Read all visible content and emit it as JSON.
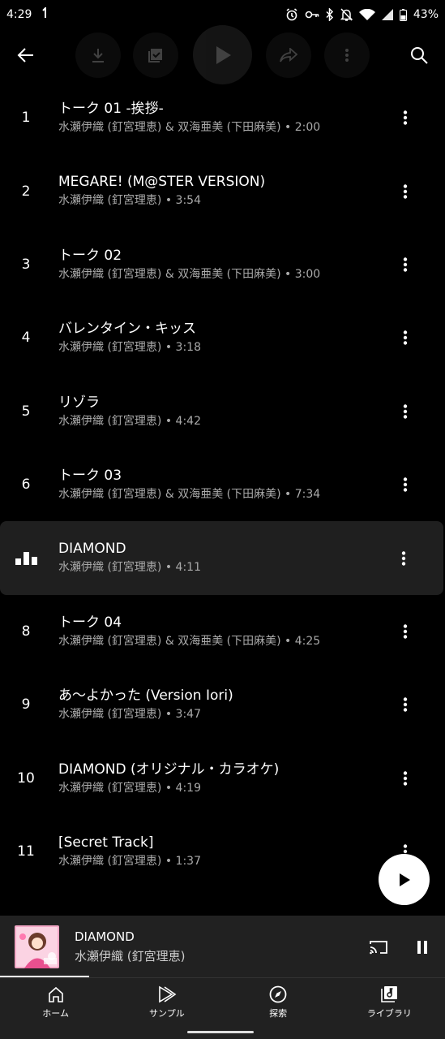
{
  "status_bar": {
    "time": "4:29",
    "battery": "43%"
  },
  "tracks": [
    {
      "number": "1",
      "title": "トーク 01 -挨拶-",
      "subtitle": "水瀬伊織 (釘宮理恵) & 双海亜美 (下田麻美) • 2:00"
    },
    {
      "number": "2",
      "title": "MEGARE! (M@STER VERSION)",
      "subtitle": "水瀬伊織 (釘宮理恵) • 3:54"
    },
    {
      "number": "3",
      "title": "トーク 02",
      "subtitle": "水瀬伊織 (釘宮理恵) & 双海亜美 (下田麻美) • 3:00"
    },
    {
      "number": "4",
      "title": "バレンタイン・キッス",
      "subtitle": "水瀬伊織 (釘宮理恵) • 3:18"
    },
    {
      "number": "5",
      "title": "リゾラ",
      "subtitle": "水瀬伊織 (釘宮理恵) • 4:42"
    },
    {
      "number": "6",
      "title": "トーク 03",
      "subtitle": "水瀬伊織 (釘宮理恵) & 双海亜美 (下田麻美) • 7:34"
    },
    {
      "number": "",
      "title": "DIAMOND",
      "subtitle": "水瀬伊織 (釘宮理恵) • 4:11",
      "playing": true
    },
    {
      "number": "8",
      "title": "トーク 04",
      "subtitle": "水瀬伊織 (釘宮理恵) & 双海亜美 (下田麻美) • 4:25"
    },
    {
      "number": "9",
      "title": "あ～よかった (Version Iori)",
      "subtitle": "水瀬伊織 (釘宮理恵) • 3:47"
    },
    {
      "number": "10",
      "title": "DIAMOND (オリジナル・カラオケ)",
      "subtitle": "水瀬伊織 (釘宮理恵) • 4:19"
    },
    {
      "number": "11",
      "title": "[Secret Track]",
      "subtitle": "水瀬伊織 (釘宮理恵) • 1:37"
    }
  ],
  "mini_player": {
    "title": "DIAMOND",
    "artist": "水瀬伊織 (釘宮理恵)",
    "progress": 0.2
  },
  "nav": [
    {
      "label": "ホーム",
      "icon": "home-icon"
    },
    {
      "label": "サンプル",
      "icon": "samples-icon"
    },
    {
      "label": "探索",
      "icon": "explore-icon"
    },
    {
      "label": "ライブラリ",
      "icon": "library-icon"
    }
  ]
}
